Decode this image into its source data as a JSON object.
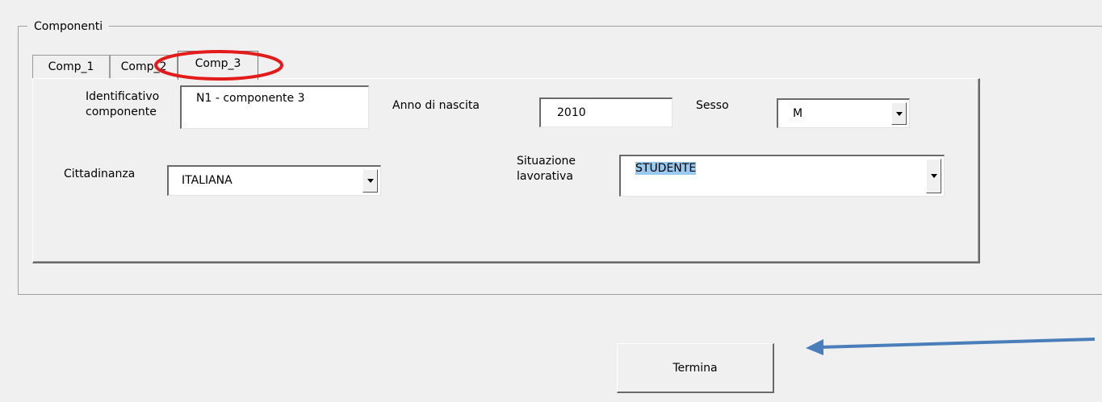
{
  "frame": {
    "title": "Componenti"
  },
  "tabs": [
    {
      "label": "Comp_1",
      "active": false
    },
    {
      "label": "Comp_2",
      "active": false
    },
    {
      "label": "Comp_3",
      "active": true
    }
  ],
  "form": {
    "identificativo": {
      "label_line1": "Identificativo",
      "label_line2": "componente",
      "value": "N1 - componente 3"
    },
    "anno": {
      "label": "Anno di nascita",
      "value": "2010"
    },
    "sesso": {
      "label": "Sesso",
      "value": "M"
    },
    "cittadinanza": {
      "label": "Cittadinanza",
      "value": "ITALIANA"
    },
    "situazione": {
      "label_line1": "Situazione",
      "label_line2": "lavorativa",
      "value": "STUDENTE"
    }
  },
  "buttons": {
    "termina": "Termina"
  },
  "colors": {
    "annotation_circle": "#e31b1b",
    "annotation_arrow": "#4a7ebb",
    "selection": "#99c9ef"
  },
  "icons": {
    "dropdown": "triangle-down-icon"
  }
}
